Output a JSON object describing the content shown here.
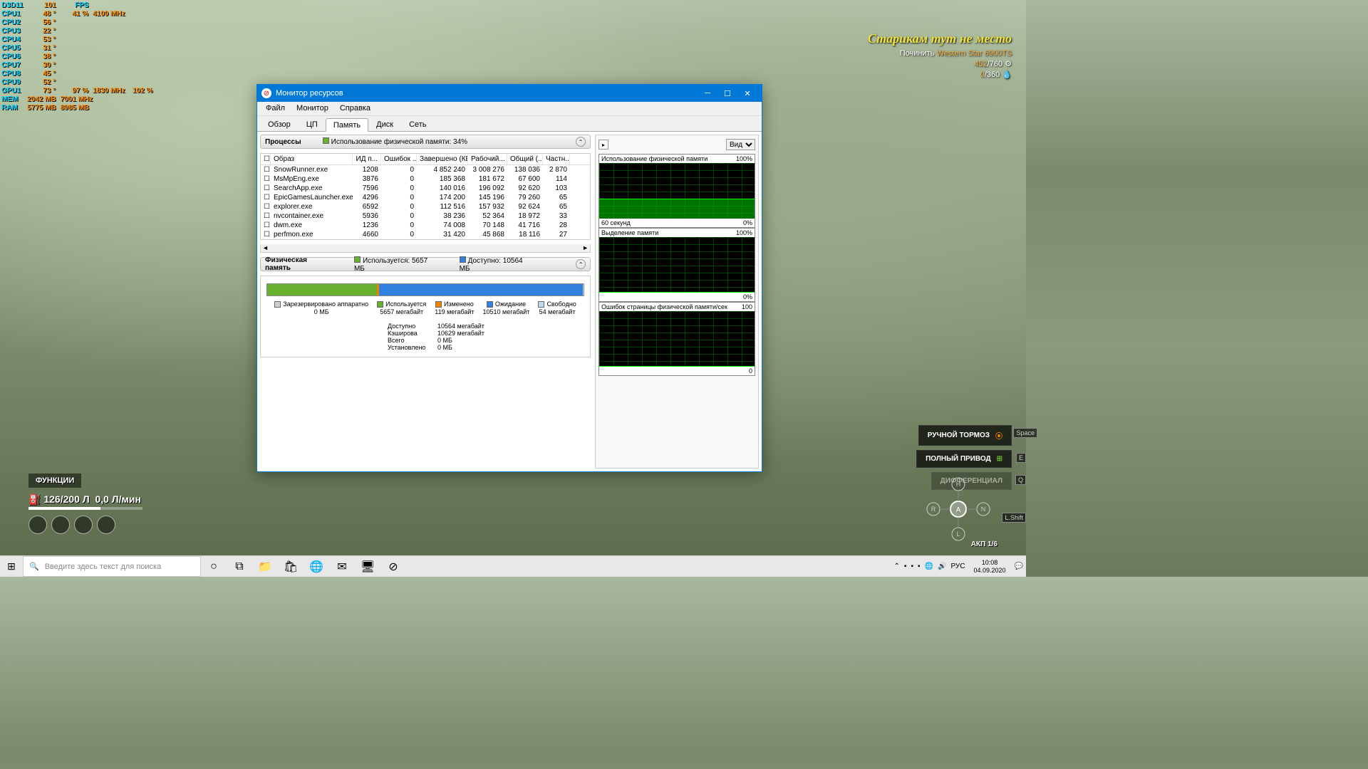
{
  "hwinfo": {
    "api": "D3D11",
    "fps": "101",
    "rows": [
      {
        "lbl": "CPU1",
        "v1": "48 °",
        "v2": "41 %",
        "v3": "4100 MHz",
        "v4": ""
      },
      {
        "lbl": "CPU2",
        "v1": "56 °",
        "v2": "",
        "v3": "",
        "v4": ""
      },
      {
        "lbl": "CPU3",
        "v1": "22 °",
        "v2": "",
        "v3": "",
        "v4": ""
      },
      {
        "lbl": "CPU4",
        "v1": "53 °",
        "v2": "",
        "v3": "",
        "v4": ""
      },
      {
        "lbl": "CPU5",
        "v1": "31 °",
        "v2": "",
        "v3": "",
        "v4": ""
      },
      {
        "lbl": "CPU6",
        "v1": "38 °",
        "v2": "",
        "v3": "",
        "v4": ""
      },
      {
        "lbl": "CPU7",
        "v1": "30 °",
        "v2": "",
        "v3": "",
        "v4": ""
      },
      {
        "lbl": "CPU8",
        "v1": "45 °",
        "v2": "",
        "v3": "",
        "v4": ""
      },
      {
        "lbl": "CPU9",
        "v1": "52 °",
        "v2": "",
        "v3": "",
        "v4": ""
      },
      {
        "lbl": "GPU1",
        "v1": "73 °",
        "v2": "97 %",
        "v3": "1830 MHz",
        "v4": "102 %"
      },
      {
        "lbl": "MEM",
        "v1": "2042 MB",
        "v2": "7001 MHz",
        "v3": "",
        "v4": ""
      },
      {
        "lbl": "RAM",
        "v1": "5775 MB",
        "v2": "8985 MB",
        "v3": "",
        "v4": ""
      }
    ]
  },
  "game": {
    "mission_title": "Старикам тут не место",
    "repair_label": "Починить",
    "vehicle": "Western Star 6900TS",
    "stat1_cur": "452",
    "stat1_max": "/760",
    "stat2_cur": "0",
    "stat2_max": "/360",
    "btn_handbrake": "РУЧНОЙ ТОРМОЗ",
    "btn_awd": "ПОЛНЫЙ ПРИВОД",
    "btn_diff": "ДИФФЕРЕНЦИАЛ",
    "key_space": "Space",
    "key_e": "E",
    "key_q": "Q",
    "key_lshift": "L.Shift",
    "gear_label": "АКП 1/6",
    "functions": "ФУНКЦИИ",
    "fuel_cur": "126",
    "fuel_max": "/200 Л",
    "fuel_rate": "0,0 Л/мин"
  },
  "rm": {
    "title": "Монитор ресурсов",
    "menu": [
      "Файл",
      "Монитор",
      "Справка"
    ],
    "tabs": [
      "Обзор",
      "ЦП",
      "Память",
      "Диск",
      "Сеть"
    ],
    "active_tab": 2,
    "sec_processes": "Процессы",
    "sec_proc_stat": "Использование физической памяти: 34%",
    "cols": [
      "Образ",
      "ИД п...",
      "Ошибок ...",
      "Завершено (КБ)",
      "Рабочий...",
      "Общий (...",
      "Частн..."
    ],
    "rows": [
      {
        "img": "SnowRunner.exe",
        "pid": "1208",
        "err": "0",
        "comp": "4 852 240",
        "work": "3 008 276",
        "tot": "138 036",
        "priv": "2 870"
      },
      {
        "img": "MsMpEng.exe",
        "pid": "3876",
        "err": "0",
        "comp": "185 368",
        "work": "181 672",
        "tot": "67 600",
        "priv": "114"
      },
      {
        "img": "SearchApp.exe",
        "pid": "7596",
        "err": "0",
        "comp": "140 016",
        "work": "196 092",
        "tot": "92 620",
        "priv": "103"
      },
      {
        "img": "EpicGamesLauncher.exe",
        "pid": "4296",
        "err": "0",
        "comp": "174 200",
        "work": "145 196",
        "tot": "79 260",
        "priv": "65"
      },
      {
        "img": "explorer.exe",
        "pid": "6592",
        "err": "0",
        "comp": "112 516",
        "work": "157 932",
        "tot": "92 624",
        "priv": "65"
      },
      {
        "img": "nvcontainer.exe",
        "pid": "5936",
        "err": "0",
        "comp": "38 236",
        "work": "52 364",
        "tot": "18 972",
        "priv": "33"
      },
      {
        "img": "dwm.exe",
        "pid": "1236",
        "err": "0",
        "comp": "74 008",
        "work": "70 148",
        "tot": "41 716",
        "priv": "28"
      },
      {
        "img": "perfmon.exe",
        "pid": "4660",
        "err": "0",
        "comp": "31 420",
        "work": "45 868",
        "tot": "18 116",
        "priv": "27"
      }
    ],
    "sec_physmem": "Физическая память",
    "physmem_used": "Используется: 5657 МБ",
    "physmem_avail": "Доступно: 10564 МБ",
    "legend": [
      {
        "color": "#d0d0d0",
        "label": "Зарезервировано аппаратно",
        "val": "0 МБ"
      },
      {
        "color": "#6ab02f",
        "label": "Используется",
        "val": "5657 мегабайт"
      },
      {
        "color": "#f08000",
        "label": "Изменено",
        "val": "119 мегабайт"
      },
      {
        "color": "#3080e0",
        "label": "Ожидание",
        "val": "10510 мегабайт"
      },
      {
        "color": "#c0d8f0",
        "label": "Свободно",
        "val": "54 мегабайт"
      }
    ],
    "summary": [
      {
        "l": "Доступно",
        "v": "10564 мегабайт"
      },
      {
        "l": "Кэширова",
        "v": "10629 мегабайт"
      },
      {
        "l": "Всего",
        "v": "0 МБ"
      },
      {
        "l": "Установлено",
        "v": "0 МБ"
      }
    ],
    "view_label": "Вид",
    "charts": [
      {
        "title": "Использование физической памяти",
        "max": "100%",
        "fill": 34,
        "foot_l": "60 секунд",
        "foot_r": "0%"
      },
      {
        "title": "Выделение памяти",
        "max": "100%",
        "fill": 0,
        "foot_l": "",
        "foot_r": "0%"
      },
      {
        "title": "Ошибок страницы физической памяти/сек",
        "max": "100",
        "fill": 0,
        "foot_l": "",
        "foot_r": "0"
      }
    ]
  },
  "taskbar": {
    "search_placeholder": "Введите здесь текст для поиска",
    "lang": "РУС",
    "time": "10:08",
    "date": "04.09.2020"
  },
  "chart_data": [
    {
      "type": "area",
      "title": "Использование физической памяти",
      "ylim": [
        0,
        100
      ],
      "ylabel": "%",
      "x": "60 секунд",
      "series": [
        {
          "name": "usage",
          "values": [
            34,
            34,
            34,
            34,
            34,
            34,
            34,
            34,
            34,
            34
          ]
        }
      ]
    },
    {
      "type": "area",
      "title": "Выделение памяти",
      "ylim": [
        0,
        100
      ],
      "ylabel": "%",
      "series": [
        {
          "name": "commit",
          "values": [
            0,
            0,
            0,
            0,
            0,
            0,
            0,
            0,
            0,
            0
          ]
        }
      ]
    },
    {
      "type": "line",
      "title": "Ошибок страницы физической памяти/сек",
      "ylim": [
        0,
        100
      ],
      "series": [
        {
          "name": "faults",
          "values": [
            0,
            0,
            0,
            0,
            0,
            0,
            0,
            0,
            0,
            0
          ]
        }
      ]
    },
    {
      "type": "bar",
      "title": "Физическая память",
      "categories": [
        "Зарезервировано аппаратно",
        "Используется",
        "Изменено",
        "Ожидание",
        "Свободно"
      ],
      "values": [
        0,
        5657,
        119,
        10510,
        54
      ],
      "ylabel": "МБ"
    }
  ]
}
